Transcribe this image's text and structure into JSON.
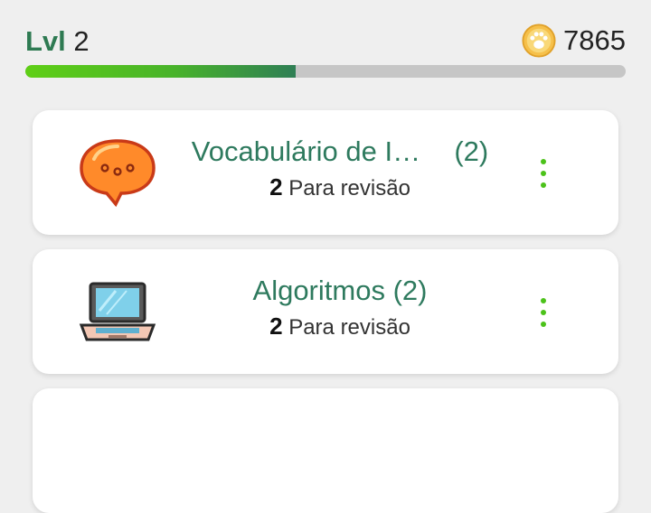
{
  "header": {
    "level_label": "Lvl",
    "level_value": "2",
    "coins": "7865",
    "coin_icon": "paw-coin-icon",
    "xp_progress_fraction": 0.45
  },
  "colors": {
    "accent_green": "#2e7a52",
    "progress_green": "#5fcf16",
    "menu_dot_green": "#4cc21a",
    "background": "#efefef"
  },
  "cards": [
    {
      "title": "Vocabulário de I…",
      "count": "(2)",
      "review_count": "2",
      "review_label": "Para revisão",
      "icon": "speech-bubble-icon"
    },
    {
      "title": "Algoritmos",
      "count": "(2)",
      "review_count": "2",
      "review_label": "Para revisão",
      "icon": "laptop-icon"
    }
  ]
}
